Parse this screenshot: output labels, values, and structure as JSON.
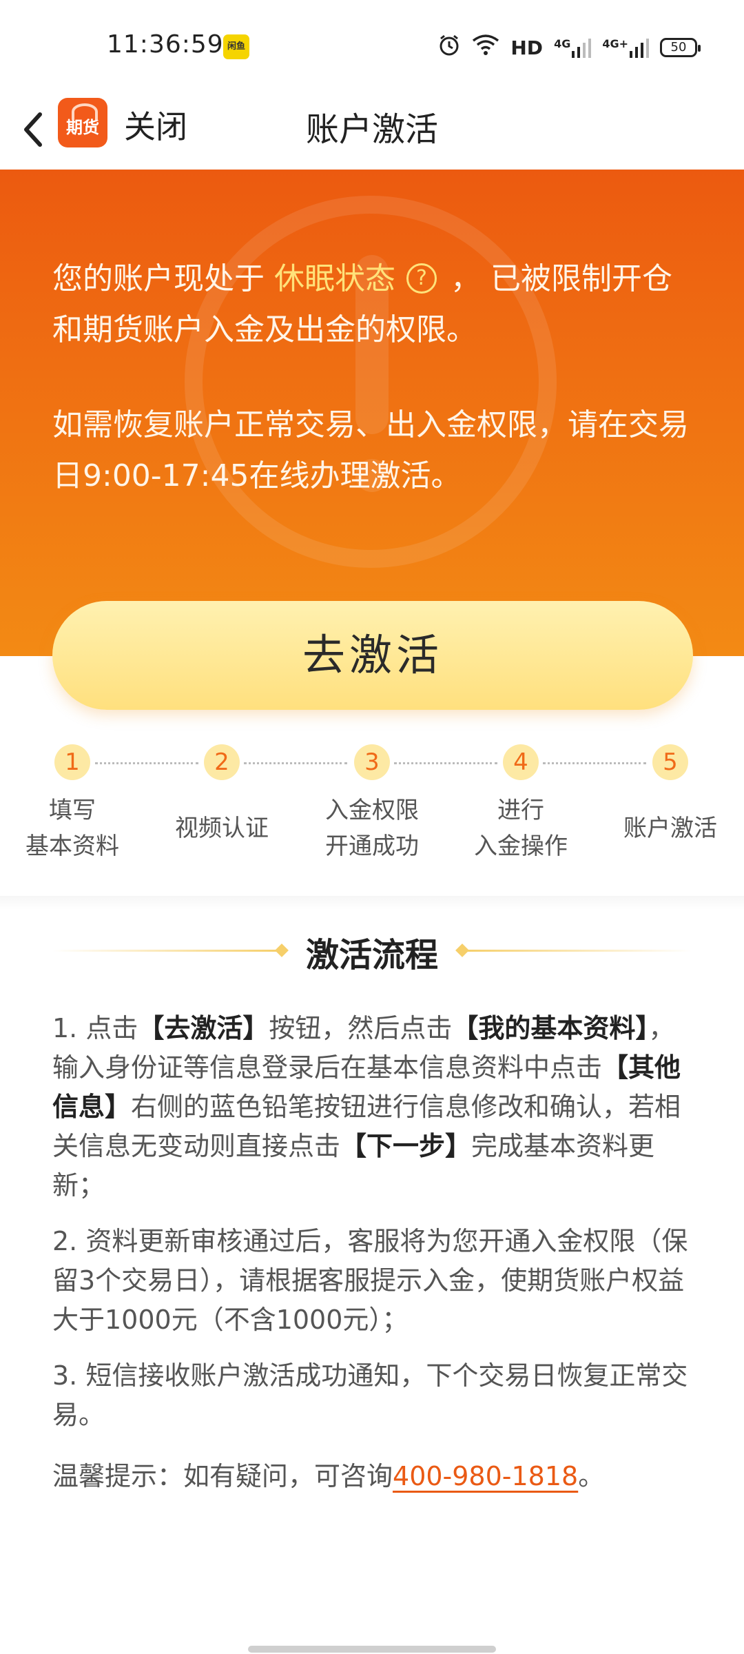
{
  "status_bar": {
    "time": "11:36:59",
    "notification_app": "闲鱼",
    "network": "HD",
    "signal1": "4G",
    "signal2": "4G+",
    "battery": "50"
  },
  "header": {
    "app_logo_text": "期货",
    "close_label": "关闭",
    "title": "账户激活"
  },
  "hero": {
    "line1_prefix": "您的账户现处于 ",
    "status_highlight": "休眠状态",
    "line1_suffix": "， 已被限制开仓和期货账户入金及出金的权限。",
    "para2": "如需恢复账户正常交易、出入金权限，请在交易日9:00-17:45在线办理激活。"
  },
  "activate_button": {
    "label": "去激活"
  },
  "steps": [
    {
      "num": "1",
      "label": "填写\n基本资料"
    },
    {
      "num": "2",
      "label": "视频认证"
    },
    {
      "num": "3",
      "label": "入金权限\n开通成功"
    },
    {
      "num": "4",
      "label": "进行\n入金操作"
    },
    {
      "num": "5",
      "label": "账户激活"
    }
  ],
  "process": {
    "title": "激活流程",
    "item1": {
      "t1": "1. 点击",
      "b1": "【去激活】",
      "t2": "按钮，然后点击",
      "b2": "【我的基本资料】",
      "t3": "，输入身份证等信息登录后在基本信息资料中点击",
      "b3": "【其他信息】",
      "t4": "右侧的蓝色铅笔按钮进行信息修改和确认，若相关信息无变动则直接点击",
      "b4": "【下一步】",
      "t5": "完成基本资料更新；"
    },
    "item2": "2. 资料更新审核通过后，客服将为您开通入金权限（保留3个交易日），请根据客服提示入金，使期货账户权益大于1000元（不含1000元）；",
    "item3": "3. 短信接收账户激活成功通知，下个交易日恢复正常交易。",
    "tip_prefix": "温馨提示：如有疑问，可咨询",
    "phone": "400-980-1818",
    "tip_suffix": "。"
  }
}
